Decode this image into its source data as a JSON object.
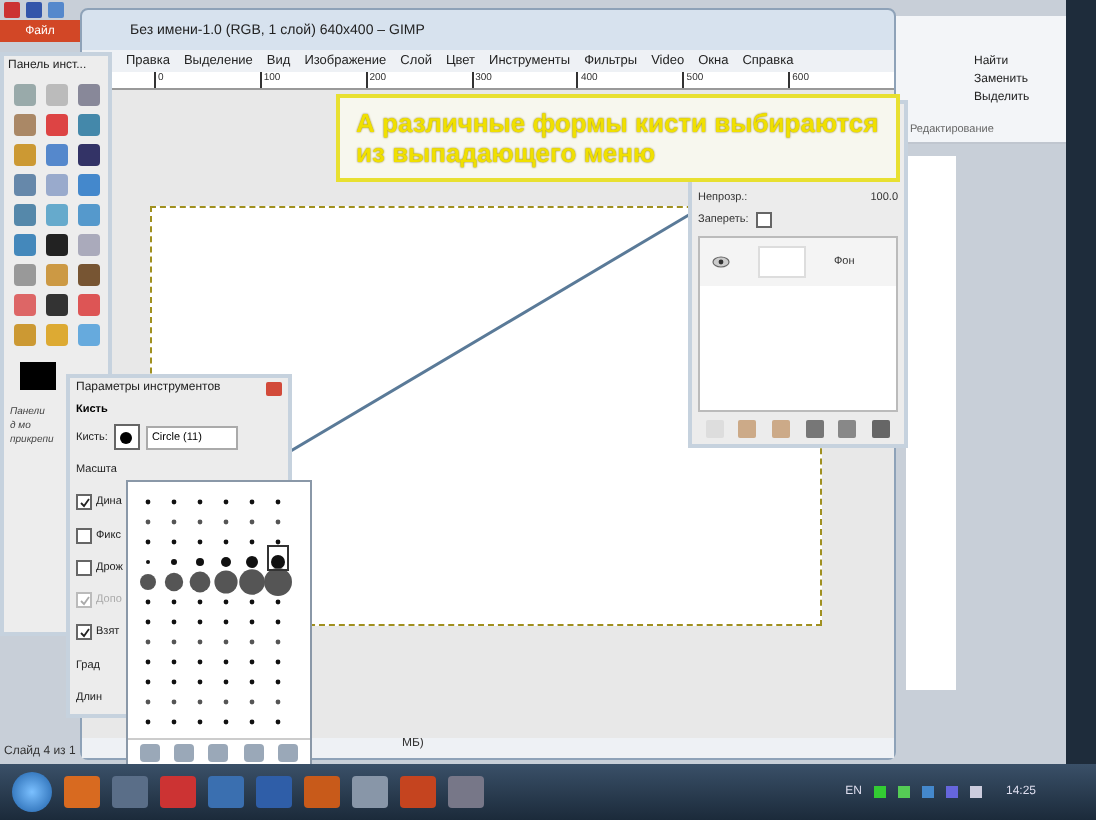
{
  "powerpoint": {
    "file_tab": "Файл",
    "status": "Слайд 4 из 1",
    "ribbon": {
      "buttons": [
        {
          "label": "Найти"
        },
        {
          "label": "Заменить"
        },
        {
          "label": "Выделить"
        }
      ],
      "group": "Редактирование"
    }
  },
  "gimp": {
    "title": "Без имени-1.0 (RGB, 1 слой) 640x400 – GIMP",
    "menu": [
      "Правка",
      "Выделение",
      "Вид",
      "Изображение",
      "Слой",
      "Цвет",
      "Инструменты",
      "Фильтры",
      "Video",
      "Окна",
      "Справка"
    ],
    "ruler": [
      "0",
      "100",
      "200",
      "300",
      "400",
      "500",
      "600"
    ],
    "status": "МБ)"
  },
  "callout": {
    "text": "А различные формы кисти выбираются из выпадающего меню"
  },
  "toolbox": {
    "title": "Панель инст...",
    "hint": "Панели д мо прикрепи"
  },
  "tool_options": {
    "title": "Параметры инструментов",
    "section": "Кисть",
    "brush_label": "Кисть:",
    "brush_name": "Circle (11)",
    "rows": [
      {
        "kind": "label",
        "label": "Масшта"
      },
      {
        "kind": "checkbox",
        "label": "Дина",
        "checked": true,
        "disabled": false
      },
      {
        "kind": "checkbox",
        "label": "Фикс",
        "checked": false,
        "disabled": false
      },
      {
        "kind": "checkbox",
        "label": "Дрож",
        "checked": false,
        "disabled": false
      },
      {
        "kind": "checkbox",
        "label": "Допо",
        "checked": true,
        "disabled": true
      },
      {
        "kind": "checkbox",
        "label": "Взят",
        "checked": true,
        "disabled": false
      },
      {
        "kind": "label",
        "label": "Град"
      },
      {
        "kind": "label",
        "label": "Длин"
      }
    ]
  },
  "layers": {
    "opacity_label": "Непрозр.:",
    "opacity": "100.0",
    "lock_label": "Запереть:",
    "locked": false,
    "layer": {
      "name": "Фон",
      "visible": true
    }
  },
  "taskbar": {
    "lang": "EN",
    "time": "14:25"
  }
}
